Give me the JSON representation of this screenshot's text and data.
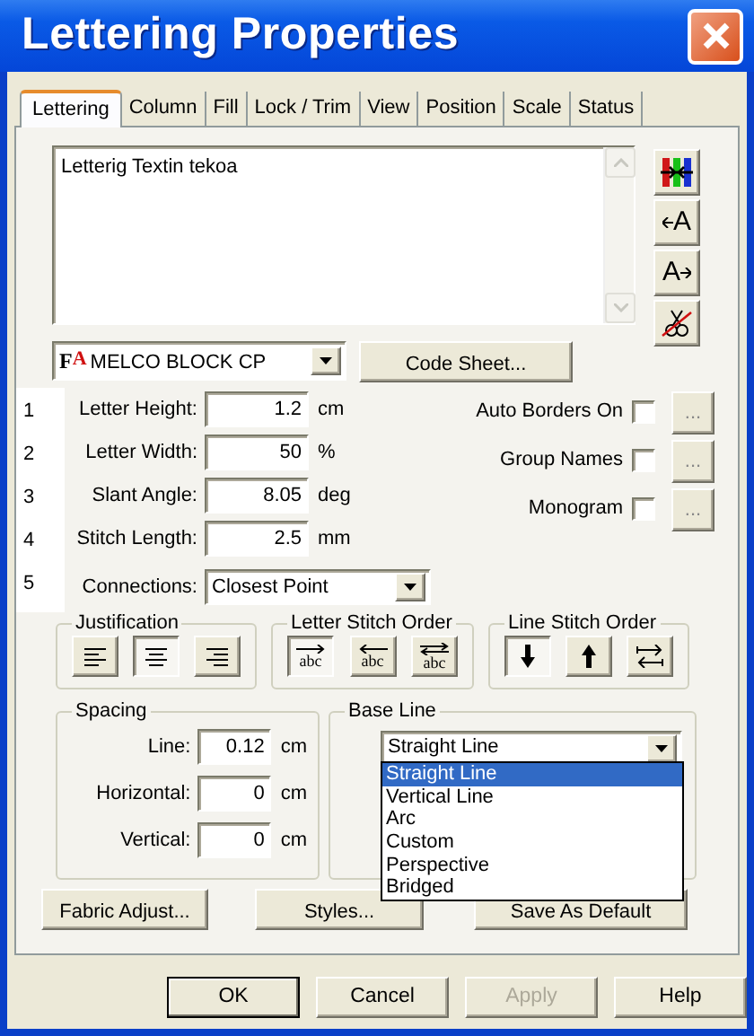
{
  "window": {
    "title": "Lettering Properties"
  },
  "tabs": [
    {
      "label": "Lettering",
      "selected": true
    },
    {
      "label": "Column",
      "selected": false
    },
    {
      "label": "Fill",
      "selected": false
    },
    {
      "label": "Lock / Trim",
      "selected": false
    },
    {
      "label": "View",
      "selected": false
    },
    {
      "label": "Position",
      "selected": false
    },
    {
      "label": "Scale",
      "selected": false
    },
    {
      "label": "Status",
      "selected": false
    }
  ],
  "text": "Letterig Textin tekoa",
  "tools": [
    {
      "kind": "colors"
    },
    {
      "kind": "shift_left",
      "label": "A"
    },
    {
      "kind": "shift_right",
      "label": "A"
    },
    {
      "kind": "cut"
    }
  ],
  "font": {
    "marks": [
      "F",
      "A"
    ],
    "value": "MELCO BLOCK CP"
  },
  "code_sheet_button": "Code Sheet...",
  "line_numbers": [
    "1",
    "2",
    "3",
    "4",
    "5"
  ],
  "measures": [
    {
      "label": "Letter Height:",
      "value": "1.2",
      "unit": "cm"
    },
    {
      "label": "Letter Width:",
      "value": "50",
      "unit": "%"
    },
    {
      "label": "Slant Angle:",
      "value": "8.05",
      "unit": "deg"
    },
    {
      "label": "Stitch Length:",
      "value": "2.5",
      "unit": "mm"
    }
  ],
  "connections": {
    "label": "Connections:",
    "value": "Closest Point"
  },
  "options": [
    {
      "label": "Auto Borders On",
      "checked": false,
      "more": "..."
    },
    {
      "label": "Group Names",
      "checked": false,
      "more": "..."
    },
    {
      "label": "Monogram",
      "checked": false,
      "more": "..."
    }
  ],
  "justification": {
    "title": "Justification",
    "buttons": [
      {
        "kind": "left",
        "selected": false
      },
      {
        "kind": "center",
        "selected": true
      },
      {
        "kind": "right",
        "selected": false
      }
    ]
  },
  "letter_stitch_order": {
    "title": "Letter Stitch Order",
    "buttons": [
      {
        "kind": "forward",
        "label": "abc",
        "selected": true
      },
      {
        "kind": "backward",
        "label": "abc",
        "selected": false
      },
      {
        "kind": "both",
        "label": "abc",
        "selected": false
      }
    ]
  },
  "line_stitch_order": {
    "title": "Line Stitch Order",
    "buttons": [
      {
        "kind": "down",
        "selected": true
      },
      {
        "kind": "up",
        "selected": false
      },
      {
        "kind": "alternate",
        "selected": false
      }
    ]
  },
  "spacing": {
    "title": "Spacing",
    "fields": [
      {
        "label": "Line:",
        "value": "0.12",
        "unit": "cm"
      },
      {
        "label": "Horizontal:",
        "value": "0",
        "unit": "cm"
      },
      {
        "label": "Vertical:",
        "value": "0",
        "unit": "cm"
      }
    ]
  },
  "base_line": {
    "title": "Base Line",
    "value": "Straight Line",
    "expanded": true,
    "options": [
      {
        "label": "Straight Line",
        "selected": true
      },
      {
        "label": "Vertical Line",
        "selected": false
      },
      {
        "label": "Arc",
        "selected": false
      },
      {
        "label": "Custom",
        "selected": false
      },
      {
        "label": "Perspective",
        "selected": false
      },
      {
        "label": "Bridged",
        "selected": false
      }
    ]
  },
  "action_buttons": [
    "Fabric Adjust...",
    "Styles...",
    "Save As Default"
  ],
  "dialog_buttons": [
    {
      "label": "OK",
      "default": true,
      "disabled": false
    },
    {
      "label": "Cancel",
      "default": false,
      "disabled": false
    },
    {
      "label": "Apply",
      "default": false,
      "disabled": true
    },
    {
      "label": "Help",
      "default": false,
      "disabled": false
    }
  ]
}
